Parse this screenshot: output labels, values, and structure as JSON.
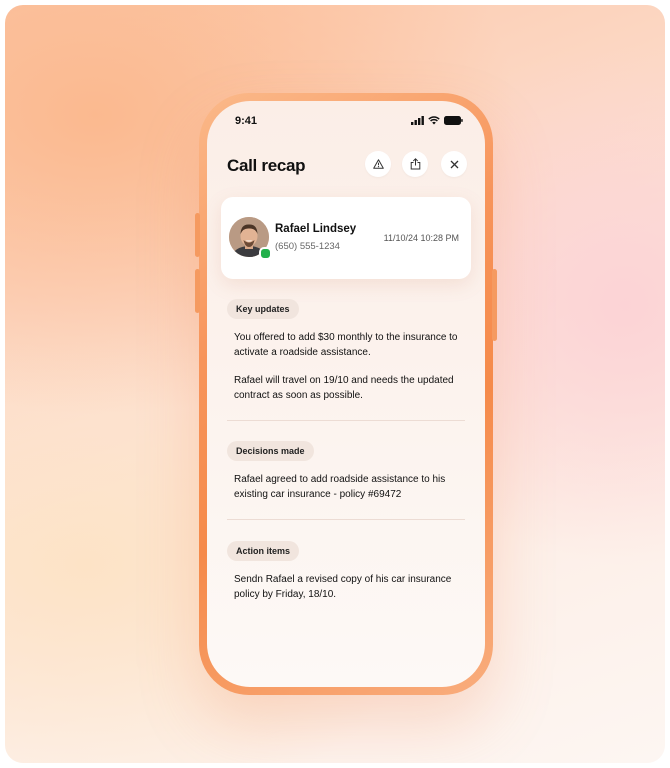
{
  "status_bar": {
    "time": "9:41"
  },
  "header": {
    "title": "Call recap"
  },
  "contact": {
    "name": "Rafael Lindsey",
    "phone": "(650) 555-1234",
    "datetime": "11/10/24 10:28 PM"
  },
  "sections": [
    {
      "label": "Key updates",
      "paragraphs": [
        "You offered to add $30 monthly to the insurance to activate a roadside assistance.",
        "Rafael will travel on 19/10 and needs the updated contract as soon as possible."
      ]
    },
    {
      "label": "Decisions made",
      "paragraphs": [
        "Rafael agreed to add roadside assistance to his existing car insurance - policy #69472"
      ]
    },
    {
      "label": "Action items",
      "paragraphs": [
        "Sendn Rafael a revised copy of his car insurance policy by Friday, 18/10."
      ]
    }
  ],
  "icons": {
    "status": [
      "signal-icon",
      "wifi-icon",
      "battery-icon"
    ],
    "header": [
      "warning-icon",
      "share-icon",
      "close-icon"
    ],
    "presence": "online-status-dot"
  },
  "colors": {
    "accent_orange": "#f58a4a",
    "online_green": "#22b04b"
  }
}
